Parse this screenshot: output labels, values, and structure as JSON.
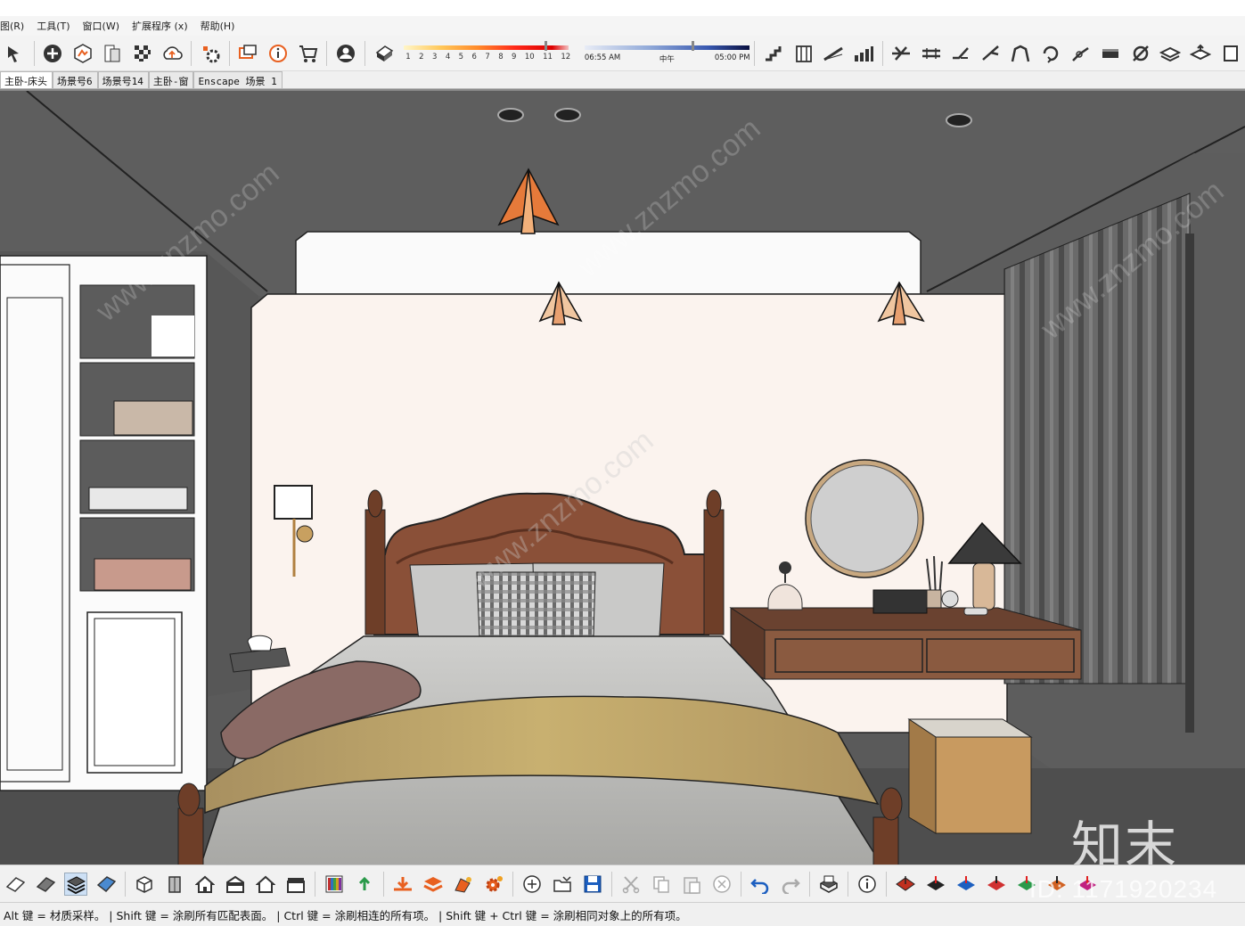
{
  "menubar": {
    "items": [
      "图(R)",
      "工具(T)",
      "窗口(W)",
      "扩展程序 (x)",
      "帮助(H)"
    ]
  },
  "toolbar": {
    "time_scale_labels": [
      "1",
      "2",
      "3",
      "4",
      "5",
      "6",
      "7",
      "8",
      "9",
      "10",
      "11",
      "12"
    ],
    "day_start": "06:55 AM",
    "day_mid": "中午",
    "day_end": "05:00 PM"
  },
  "tabs": {
    "items": [
      "主卧-床头",
      "场景号6",
      "场景号14",
      "主卧-窗",
      "Enscape 场景 1"
    ]
  },
  "status": {
    "text": "Alt 键 = 材质采样。 | Shift 键 = 涂刷所有匹配表面。 | Ctrl 键 = 涂刷相连的所有项。 | Shift 键 + Ctrl 键 = 涂刷相同对象上的所有项。"
  },
  "watermark": {
    "logo": "知末",
    "id": "ID: 1171920234",
    "site": "www.znzmo.com"
  },
  "colors": {
    "ceiling": "#5e5e5e",
    "wall": "#fbf3ee",
    "wood": "#7a4a34",
    "accent": "#e8702a"
  }
}
